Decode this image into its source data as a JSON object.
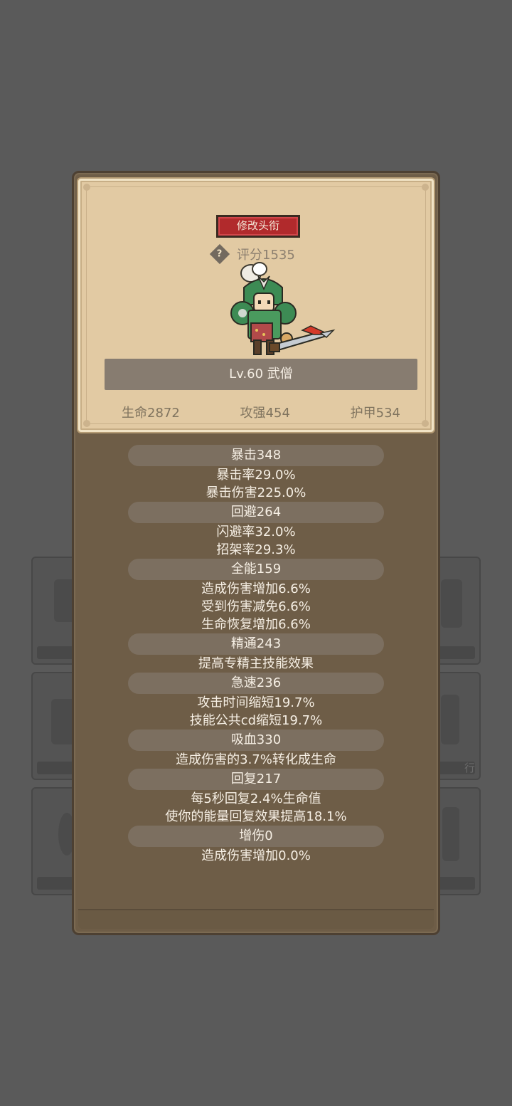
{
  "popup": {
    "title_button": "修改头衔",
    "score": "评分1535",
    "level_label": "Lv.60 武僧",
    "base_stats": {
      "hp": "生命2872",
      "attack": "攻强454",
      "armor": "护甲534"
    },
    "stats": [
      {
        "header": "暴击348",
        "lines": [
          "暴击率29.0%",
          "暴击伤害225.0%"
        ]
      },
      {
        "header": "回避264",
        "lines": [
          "闪避率32.0%",
          "招架率29.3%"
        ]
      },
      {
        "header": "全能159",
        "lines": [
          "造成伤害增加6.6%",
          "受到伤害减免6.6%",
          "生命恢复增加6.6%"
        ]
      },
      {
        "header": "精通243",
        "lines": [
          "提高专精主技能效果"
        ]
      },
      {
        "header": "急速236",
        "lines": [
          "攻击时间缩短19.7%",
          "技能公共cd缩短19.7%"
        ]
      },
      {
        "header": "吸血330",
        "lines": [
          "造成伤害的3.7%转化成生命"
        ]
      },
      {
        "header": "回复217",
        "lines": [
          "每5秒回复2.4%生命值",
          "使你的能量回复效果提高18.1%"
        ]
      },
      {
        "header": "增伤0",
        "lines": [
          "造成伤害增加0.0%"
        ]
      }
    ]
  },
  "background": {
    "slot_right_mid_label": "行"
  },
  "icons": {
    "help": "question-diamond-icon",
    "character": "warrior-monk-sprite"
  },
  "colors": {
    "title_button": "#b12a2c",
    "parchment": "#e2caa3",
    "panel": "#6e5d47"
  }
}
